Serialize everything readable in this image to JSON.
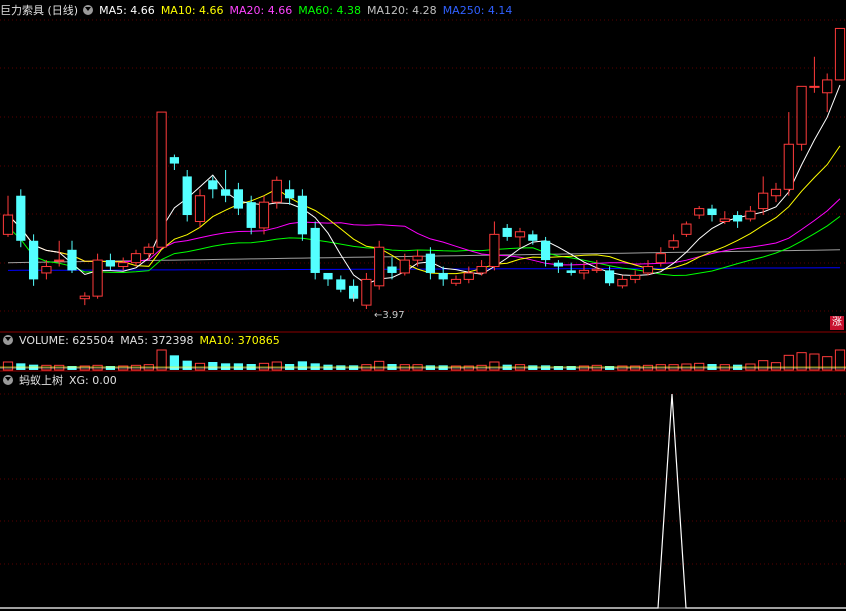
{
  "header_main": {
    "title": "巨力索具 (日线)",
    "ma5": "MA5: 4.66",
    "ma10": "MA10: 4.66",
    "ma20": "MA20: 4.66",
    "ma60": "MA60: 4.38",
    "ma120": "MA120: 4.28",
    "ma250": "MA250: 4.14"
  },
  "header_vol": {
    "volume": "VOLUME: 625504",
    "ma5": "MA5: 372398",
    "ma10": "MA10: 370865"
  },
  "header_ind": {
    "name": "蚂蚁上树",
    "xg": "XG: 0.00"
  },
  "annotations": {
    "low": "←3.97",
    "zhang": "涨"
  },
  "colors": {
    "up": "#ff3b3b",
    "down": "#54ffff",
    "ma5": "#ffffff",
    "ma10": "#ffff00",
    "ma20": "#ff00ff",
    "ma60": "#00ff00",
    "ma120": "#a0a0a0",
    "ma250": "#0000ff"
  },
  "chart_data": {
    "type": "candlestick",
    "title": "巨力索具 (日线)",
    "price_range": [
      3.75,
      6.05
    ],
    "candles": [
      [
        4.4,
        4.55,
        4.7,
        4.38
      ],
      [
        4.7,
        4.35,
        4.75,
        4.3
      ],
      [
        4.35,
        4.05,
        4.4,
        4.0
      ],
      [
        4.1,
        4.15,
        4.2,
        4.05
      ],
      [
        4.2,
        4.2,
        4.35,
        4.15
      ],
      [
        4.28,
        4.12,
        4.35,
        4.1
      ],
      [
        3.9,
        3.92,
        3.95,
        3.85
      ],
      [
        3.92,
        4.2,
        4.25,
        3.9
      ],
      [
        4.2,
        4.15,
        4.25,
        4.12
      ],
      [
        4.15,
        4.18,
        4.22,
        4.12
      ],
      [
        4.18,
        4.25,
        4.28,
        4.15
      ],
      [
        4.25,
        4.3,
        4.33,
        4.2
      ],
      [
        4.3,
        5.35,
        5.35,
        4.3
      ],
      [
        5.0,
        4.95,
        5.02,
        4.9
      ],
      [
        4.85,
        4.55,
        4.9,
        4.5
      ],
      [
        4.5,
        4.7,
        4.75,
        4.45
      ],
      [
        4.82,
        4.75,
        4.85,
        4.68
      ],
      [
        4.75,
        4.7,
        4.9,
        4.65
      ],
      [
        4.75,
        4.6,
        4.8,
        4.55
      ],
      [
        4.65,
        4.45,
        4.7,
        4.4
      ],
      [
        4.45,
        4.65,
        4.7,
        4.4
      ],
      [
        4.65,
        4.82,
        4.85,
        4.6
      ],
      [
        4.75,
        4.68,
        4.82,
        4.63
      ],
      [
        4.7,
        4.4,
        4.75,
        4.35
      ],
      [
        4.45,
        4.1,
        4.5,
        4.05
      ],
      [
        4.1,
        4.05,
        4.1,
        4.0
      ],
      [
        4.05,
        3.97,
        4.08,
        3.95
      ],
      [
        4.0,
        3.9,
        4.05,
        3.88
      ],
      [
        3.85,
        4.05,
        4.1,
        3.82
      ],
      [
        4.0,
        4.3,
        4.35,
        3.97
      ],
      [
        4.15,
        4.1,
        4.22,
        4.05
      ],
      [
        4.1,
        4.2,
        4.25,
        4.08
      ],
      [
        4.2,
        4.23,
        4.28,
        4.15
      ],
      [
        4.25,
        4.1,
        4.3,
        4.05
      ],
      [
        4.1,
        4.05,
        4.15,
        4.0
      ],
      [
        4.02,
        4.05,
        4.08,
        4.0
      ],
      [
        4.05,
        4.1,
        4.15,
        4.02
      ],
      [
        4.1,
        4.15,
        4.2,
        4.08
      ],
      [
        4.15,
        4.4,
        4.5,
        4.12
      ],
      [
        4.45,
        4.38,
        4.48,
        4.35
      ],
      [
        4.38,
        4.42,
        4.45,
        4.3
      ],
      [
        4.4,
        4.35,
        4.43,
        4.32
      ],
      [
        4.35,
        4.2,
        4.38,
        4.15
      ],
      [
        4.18,
        4.15,
        4.2,
        4.1
      ],
      [
        4.12,
        4.1,
        4.18,
        4.08
      ],
      [
        4.1,
        4.12,
        4.18,
        4.05
      ],
      [
        4.12,
        4.13,
        4.2,
        4.1
      ],
      [
        4.12,
        4.02,
        4.15,
        4.0
      ],
      [
        4.0,
        4.05,
        4.08,
        3.98
      ],
      [
        4.05,
        4.08,
        4.12,
        4.02
      ],
      [
        4.1,
        4.15,
        4.2,
        4.08
      ],
      [
        4.18,
        4.25,
        4.3,
        4.15
      ],
      [
        4.3,
        4.35,
        4.4,
        4.28
      ],
      [
        4.4,
        4.48,
        4.5,
        4.38
      ],
      [
        4.55,
        4.6,
        4.62,
        4.52
      ],
      [
        4.6,
        4.55,
        4.63,
        4.5
      ],
      [
        4.5,
        4.52,
        4.58,
        4.48
      ],
      [
        4.55,
        4.5,
        4.58,
        4.45
      ],
      [
        4.52,
        4.58,
        4.62,
        4.5
      ],
      [
        4.6,
        4.72,
        4.85,
        4.55
      ],
      [
        4.7,
        4.75,
        4.8,
        4.65
      ],
      [
        4.75,
        5.1,
        5.35,
        4.7
      ],
      [
        5.1,
        5.55,
        5.55,
        5.05
      ],
      [
        5.55,
        5.55,
        5.78,
        5.5
      ],
      [
        5.5,
        5.6,
        5.65,
        5.35
      ],
      [
        5.6,
        6.0,
        6.0,
        5.6
      ]
    ],
    "ma_lines": {
      "MA5": 4.66,
      "MA10": 4.66,
      "MA20": 4.66,
      "MA60": 4.38,
      "MA120": 4.28,
      "MA250": 4.14
    },
    "low_marker": 3.97,
    "volume": {
      "last": 625504,
      "ma5": 372398,
      "ma10": 370865,
      "values": [
        1.2,
        1.0,
        0.8,
        0.7,
        0.7,
        0.6,
        0.6,
        0.7,
        0.6,
        0.6,
        0.7,
        0.8,
        3.0,
        2.2,
        1.4,
        1.0,
        1.2,
        1.0,
        1.0,
        0.9,
        1.0,
        1.2,
        0.9,
        1.3,
        1.0,
        0.8,
        0.7,
        0.7,
        0.8,
        1.3,
        0.9,
        0.8,
        0.8,
        0.7,
        0.7,
        0.6,
        0.6,
        0.7,
        1.2,
        0.8,
        0.8,
        0.7,
        0.7,
        0.6,
        0.6,
        0.6,
        0.7,
        0.6,
        0.6,
        0.6,
        0.7,
        0.8,
        0.8,
        0.9,
        1.0,
        0.9,
        0.8,
        0.8,
        0.9,
        1.4,
        1.1,
        2.2,
        2.6,
        2.4,
        2.0,
        3.0
      ]
    },
    "indicator": {
      "name": "蚂蚁上树",
      "xg": 0.0,
      "signals": [
        0,
        0,
        0,
        0,
        0,
        0,
        0,
        0,
        0,
        0,
        0,
        0,
        0,
        0,
        0,
        0,
        0,
        0,
        0,
        0,
        0,
        0,
        0,
        0,
        0,
        0,
        0,
        0,
        0,
        0,
        0,
        0,
        0,
        0,
        0,
        0,
        0,
        0,
        0,
        0,
        0,
        0,
        0,
        0,
        0,
        0,
        0,
        0,
        0,
        0,
        0,
        0,
        0,
        0,
        0,
        0,
        0,
        0,
        0,
        0,
        0,
        0,
        0,
        0,
        0,
        0,
        0,
        0,
        0,
        0,
        0,
        0,
        0,
        0,
        0,
        0,
        0,
        0,
        0,
        0,
        0,
        0,
        0,
        0,
        0,
        0,
        0,
        0,
        0,
        0,
        0,
        0,
        0,
        0,
        0,
        0,
        0,
        0,
        0,
        0,
        0,
        0,
        0,
        0,
        0,
        0,
        0,
        0,
        0,
        0,
        0,
        0,
        0,
        0,
        0,
        0,
        0,
        0,
        0,
        0
      ],
      "spike_index": 82
    }
  }
}
